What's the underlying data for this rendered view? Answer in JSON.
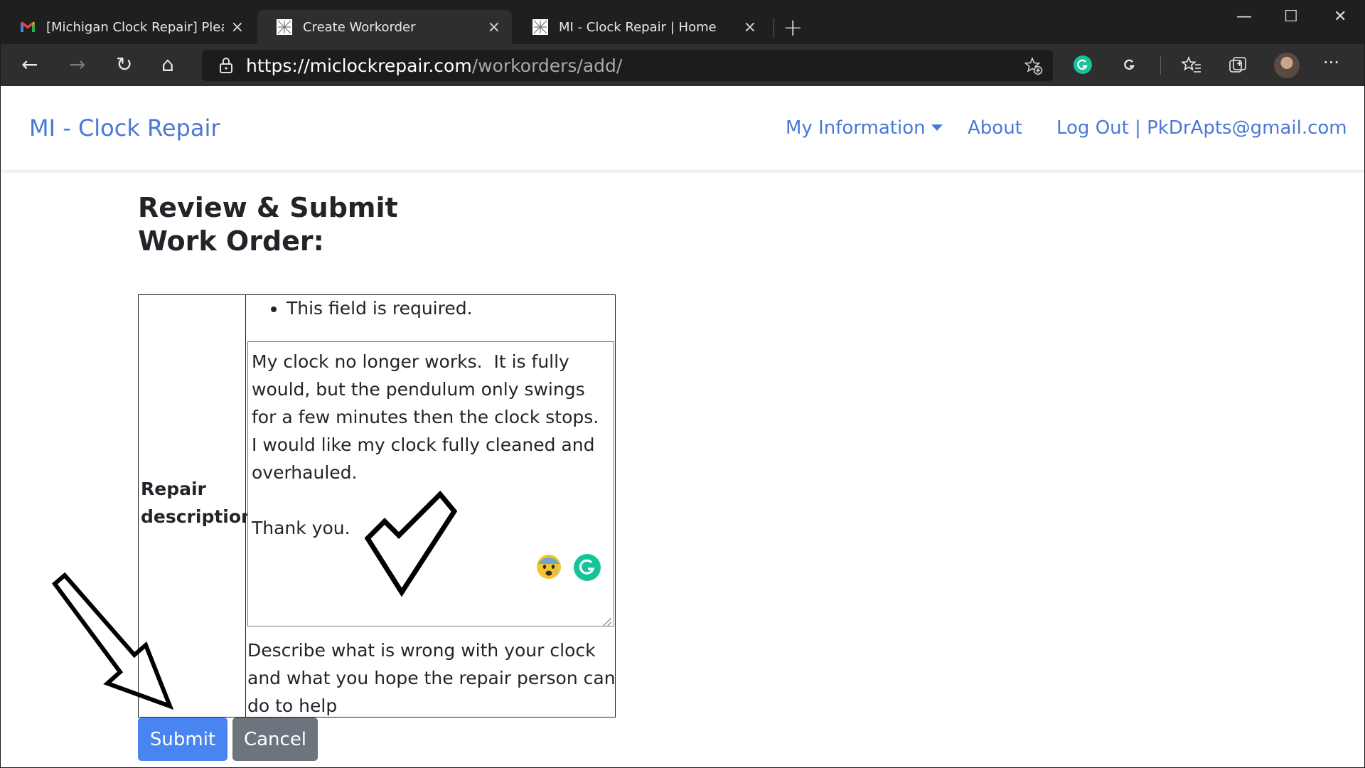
{
  "browser": {
    "tabs": [
      {
        "title": "[Michigan Clock Repair] Please C",
        "favicon": "gmail-icon",
        "active": false
      },
      {
        "title": "Create Workorder",
        "favicon": "site-icon",
        "active": true
      },
      {
        "title": "MI - Clock Repair | Home",
        "favicon": "site-icon",
        "active": false
      }
    ],
    "new_tab_label": "+",
    "close_glyph": "×",
    "window_controls": {
      "minimize": "—",
      "maximize": "☐",
      "close": "✕"
    },
    "url_host": "https://miclockrepair.com",
    "url_path": "/workorders/add/",
    "toolbar_glyphs": {
      "back": "←",
      "forward": "→",
      "reload": "↻",
      "home": "⌂",
      "more": "···"
    },
    "accent_colors": {
      "grammarly": "#15c39a",
      "tab_bar": "#1f1f1f",
      "toolbar": "#2e2e2e"
    }
  },
  "site": {
    "brand": "MI - Clock Repair",
    "nav": {
      "my_information": "My Information",
      "about": "About",
      "logout": "Log Out | PkDrApts@gmail.com"
    },
    "link_color": "#4a78d6"
  },
  "form": {
    "heading": "Review & Submit Work Order:",
    "field_label": "Repair description:",
    "errors": [
      "This field is required."
    ],
    "description_value": "My clock no longer works.  It is fully would, but the pendulum only swings for a few minutes then the clock stops.  I would like my clock fully cleaned and overhauled.\n\nThank you.",
    "help_text": "Describe what is wrong with your clock and what you hope the repair person can do to help",
    "submit_label": "Submit",
    "cancel_label": "Cancel",
    "submit_color": "#4a84f0",
    "cancel_color": "#6c757d"
  },
  "annotations": {
    "checkmark": "checkmark-annotation",
    "arrow": "arrow-annotation"
  }
}
